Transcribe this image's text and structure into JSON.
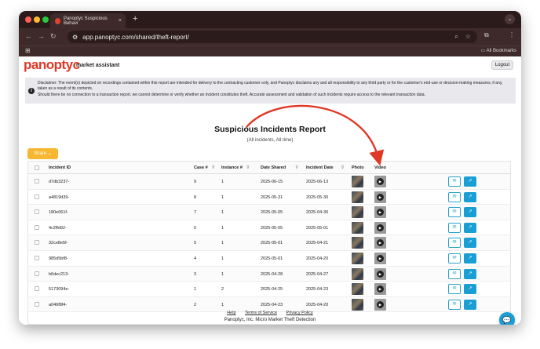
{
  "browser": {
    "tab_title": "Panoptyc Suspicious Behavi",
    "tab_close": "×",
    "new_tab": "+",
    "url": "app.panoptyc.com/shared/theft-report/",
    "bookmarks_label": "All Bookmarks"
  },
  "header": {
    "logo": "panoptyc",
    "subtitle": "market assistant",
    "logout_label": "Logout"
  },
  "disclaimer": {
    "line1": "Disclaimer: The event(s) depicted on recordings contained within this report are intended for delivery to the contracting customer only, and Panoptyc disclaims any and all responsibility to any third party or for the customer's end-use or decision-making measures, if any, taken as a result of its contents.",
    "line2": "Should there be no connection to a transaction report, we cannot determine or verify whether an incident constitutes theft. Accurate assessment and validation of such incidents require access to the relevant transaction data."
  },
  "report": {
    "title": "Suspicious Incidents Report",
    "subtitle": "(All incidents, All time)",
    "share_label": "Share ⌄"
  },
  "table": {
    "columns": [
      "Incident ID",
      "Case #",
      "Instance #",
      "Date Shared",
      "Incident Date",
      "Photo",
      "Video"
    ],
    "rows": [
      {
        "id": "d7db3237-",
        "case": "9",
        "instance": "1",
        "shared": "2025-06-15",
        "incident": "2025-06-13"
      },
      {
        "id": "a4819d39-",
        "case": "8",
        "instance": "1",
        "shared": "2025-05-31",
        "incident": "2025-05-30"
      },
      {
        "id": "180e061f-",
        "case": "7",
        "instance": "1",
        "shared": "2025-05-05",
        "incident": "2025-04-30"
      },
      {
        "id": "4c2ffd92-",
        "case": "6",
        "instance": "1",
        "shared": "2025-05-05",
        "incident": "2025-05-01"
      },
      {
        "id": "32ce8e5f-",
        "case": "5",
        "instance": "1",
        "shared": "2025-05-01",
        "incident": "2025-04-21"
      },
      {
        "id": "985d5bf8-",
        "case": "4",
        "instance": "1",
        "shared": "2025-05-01",
        "incident": "2025-04-20"
      },
      {
        "id": "b6dec213-",
        "case": "3",
        "instance": "1",
        "shared": "2025-04-28",
        "incident": "2025-04-27"
      },
      {
        "id": "5173094e-",
        "case": "1",
        "instance": "2",
        "shared": "2025-04-25",
        "incident": "2025-04-23"
      },
      {
        "id": "a046f8f4-",
        "case": "2",
        "instance": "1",
        "shared": "2025-04-23",
        "incident": "2025-04-20"
      }
    ]
  },
  "footer": {
    "help": "Help",
    "terms": "Terms of Service",
    "privacy": "Privacy Policy",
    "copyright": "Panoptyc, Inc. Micro Market Theft Detection"
  },
  "colors": {
    "brand": "#e03826",
    "share": "#f7b731",
    "action": "#1a9fd4"
  }
}
